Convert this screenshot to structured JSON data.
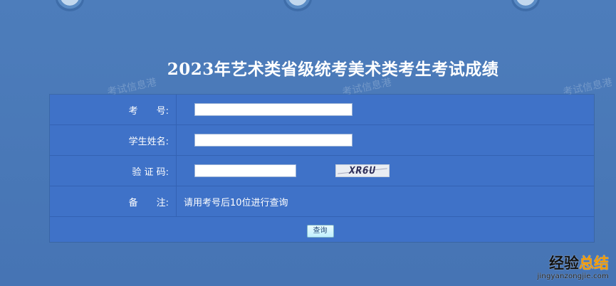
{
  "page": {
    "title": "2023年艺术类省级统考美术类考生考试成绩"
  },
  "watermarks": [
    "考试信息港",
    "考试信息港",
    "考试信息港"
  ],
  "form": {
    "exam_number": {
      "label": "考　　号:",
      "value": "",
      "placeholder": ""
    },
    "student_name": {
      "label": "学生姓名:",
      "value": "",
      "placeholder": ""
    },
    "verification_code": {
      "label": "验 证 码:",
      "value": "",
      "placeholder": "",
      "captcha_text": "XR6U"
    },
    "remarks": {
      "label": "备　　注:",
      "text": "请用考号后10位进行查询"
    },
    "submit_label": "查询"
  },
  "brand": {
    "logo_text_prefix": "经验",
    "logo_text_accent": "总结",
    "url": "jingyanzongjie.com"
  },
  "colors": {
    "background": "#4a79b8",
    "panel": "#3f72c8",
    "button": "#bff0ff",
    "accent": "#f39a00"
  },
  "icons": {
    "top_logos": [
      "globe-logo-icon",
      "globe-logo-icon",
      "globe-logo-icon"
    ]
  }
}
